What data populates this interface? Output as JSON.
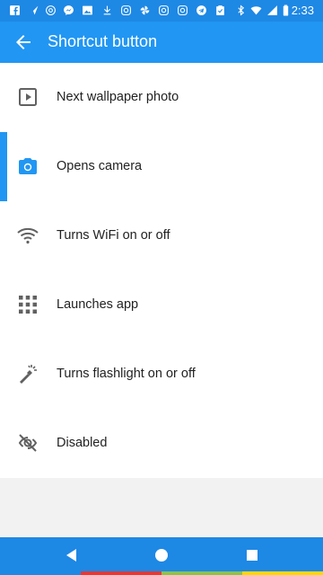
{
  "status_bar": {
    "time": "2:33",
    "icons": [
      "facebook-icon",
      "send-icon",
      "at-icon",
      "messenger-icon",
      "image-icon",
      "download-icon",
      "instagram-icon",
      "pinwheel-icon",
      "instagram-icon",
      "instagram-icon",
      "telegram-icon",
      "clipboard-check-icon",
      "bluetooth-icon",
      "wifi-icon",
      "signal-icon",
      "battery-icon"
    ]
  },
  "app_bar": {
    "title": "Shortcut button"
  },
  "list": {
    "items": [
      {
        "label": "Next wallpaper photo",
        "icon": "play-box-icon",
        "selected": false
      },
      {
        "label": "Opens camera",
        "icon": "camera-icon",
        "selected": true
      },
      {
        "label": "Turns WiFi on or off",
        "icon": "wifi-icon",
        "selected": false
      },
      {
        "label": "Launches app",
        "icon": "apps-grid-icon",
        "selected": false
      },
      {
        "label": "Turns flashlight on or off",
        "icon": "flashlight-icon",
        "selected": false
      },
      {
        "label": "Disabled",
        "icon": "eye-off-icon",
        "selected": false
      }
    ]
  },
  "colors": {
    "primary": "#2196f3",
    "status_bar": "#1e88e5",
    "icon_default": "#616161",
    "text": "#222222",
    "strip": [
      "#e53935",
      "#8bc34a",
      "#ffd600"
    ]
  }
}
